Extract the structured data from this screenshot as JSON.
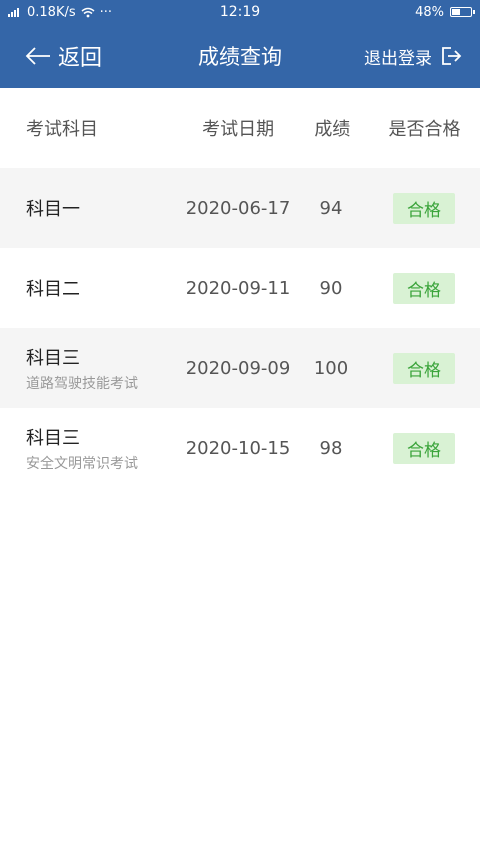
{
  "status_bar": {
    "network_speed": "0.18K/s",
    "time": "12:19",
    "battery": "48%",
    "battery_level": 0.48,
    "dots": "···"
  },
  "nav": {
    "back_label": "返回",
    "title": "成绩查询",
    "logout_label": "退出登录"
  },
  "table": {
    "headers": [
      "考试科目",
      "考试日期",
      "成绩",
      "是否合格"
    ],
    "rows": [
      {
        "subject": "科目一",
        "sub": "",
        "date": "2020-06-17",
        "score": "94",
        "status": "合格"
      },
      {
        "subject": "科目二",
        "sub": "",
        "date": "2020-09-11",
        "score": "90",
        "status": "合格"
      },
      {
        "subject": "科目三",
        "sub": "道路驾驶技能考试",
        "date": "2020-09-09",
        "score": "100",
        "status": "合格"
      },
      {
        "subject": "科目三",
        "sub": "安全文明常识考试",
        "date": "2020-10-15",
        "score": "98",
        "status": "合格"
      }
    ]
  },
  "colors": {
    "header_bg": "#3466a8",
    "pass_badge_bg": "#d9f2d4",
    "pass_badge_text": "#3aa43a",
    "alt_row_bg": "#f5f5f5"
  }
}
